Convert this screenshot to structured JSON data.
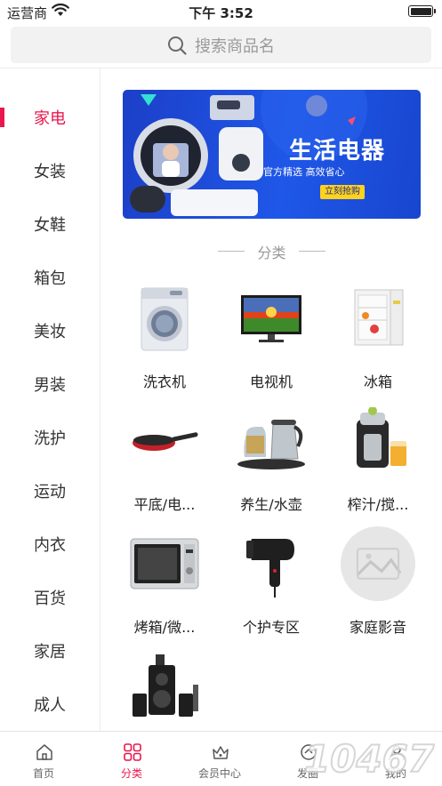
{
  "status_bar": {
    "carrier": "运营商",
    "time": "下午 3:52"
  },
  "search": {
    "placeholder": "搜索商品名"
  },
  "sidebar": {
    "active_index": 0,
    "items": [
      "家电",
      "女装",
      "女鞋",
      "箱包",
      "美妆",
      "男装",
      "洗护",
      "运动",
      "内衣",
      "百货",
      "家居",
      "成人"
    ]
  },
  "banner": {
    "title": "生活电器",
    "subtitle": "官方精选 高效省心",
    "cta": "立刻抢购"
  },
  "section": {
    "title": "分类"
  },
  "grid": {
    "items": [
      {
        "name": "洗衣机",
        "icon": "washing-machine"
      },
      {
        "name": "电视机",
        "icon": "television"
      },
      {
        "name": "冰箱",
        "icon": "refrigerator"
      },
      {
        "name": "平底/电...",
        "icon": "frying-pan"
      },
      {
        "name": "养生/水壶",
        "icon": "kettle"
      },
      {
        "name": "榨汁/搅...",
        "icon": "juicer"
      },
      {
        "name": "烤箱/微...",
        "icon": "microwave"
      },
      {
        "name": "个护专区",
        "icon": "hair-dryer"
      },
      {
        "name": "家庭影音",
        "icon": "image-placeholder"
      },
      {
        "name": "",
        "icon": "speakers"
      }
    ]
  },
  "tabbar": {
    "active_index": 1,
    "tabs": [
      {
        "label": "首页",
        "icon": "home-icon"
      },
      {
        "label": "分类",
        "icon": "category-icon"
      },
      {
        "label": "会员中心",
        "icon": "crown-icon"
      },
      {
        "label": "发圈",
        "icon": "share-icon"
      },
      {
        "label": "我的",
        "icon": "user-icon"
      }
    ]
  },
  "watermark": {
    "text": "10467"
  },
  "colors": {
    "accent": "#e8174d",
    "banner": "#1f57e8",
    "cta": "#ffd21e"
  }
}
